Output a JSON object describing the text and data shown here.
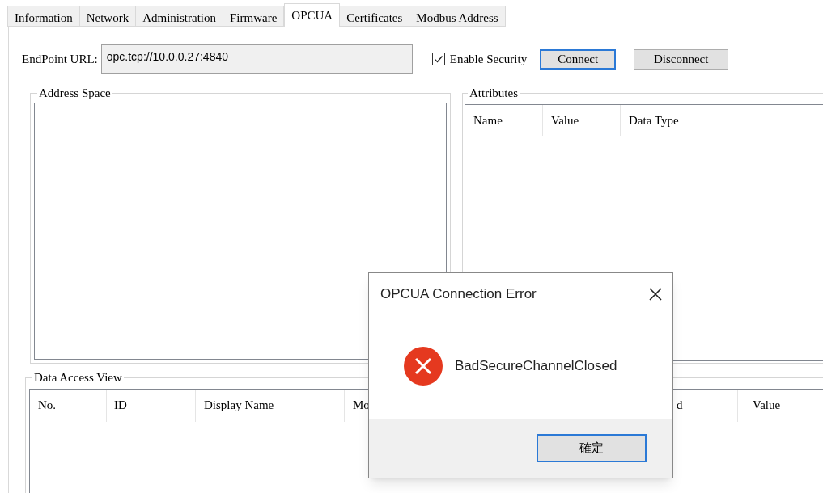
{
  "tabs": [
    {
      "label": "Information",
      "selected": false
    },
    {
      "label": "Network",
      "selected": false
    },
    {
      "label": "Administration",
      "selected": false
    },
    {
      "label": "Firmware",
      "selected": false
    },
    {
      "label": "OPCUA",
      "selected": true
    },
    {
      "label": "Certificates",
      "selected": false
    },
    {
      "label": "Modbus Address",
      "selected": false
    }
  ],
  "endpoint": {
    "label": "EndPoint URL:",
    "value": "opc.tcp://10.0.0.27:4840"
  },
  "enable_security": {
    "label": "Enable Security",
    "checked": true
  },
  "buttons": [
    {
      "label": "Connect",
      "focused": true
    },
    {
      "label": "Disconnect",
      "focused": false
    }
  ],
  "address_space": {
    "title": "Address Space"
  },
  "attributes": {
    "title": "Attributes",
    "columns": [
      "Name",
      "Value",
      "Data Type"
    ]
  },
  "data_access_view": {
    "title": "Data Access View",
    "columns": [
      "No.",
      "ID",
      "Display Name",
      "Mo",
      "d",
      "Value"
    ]
  },
  "dialog": {
    "title": "OPCUA Connection Error",
    "message": "BadSecureChannelClosed",
    "button": "確定"
  }
}
